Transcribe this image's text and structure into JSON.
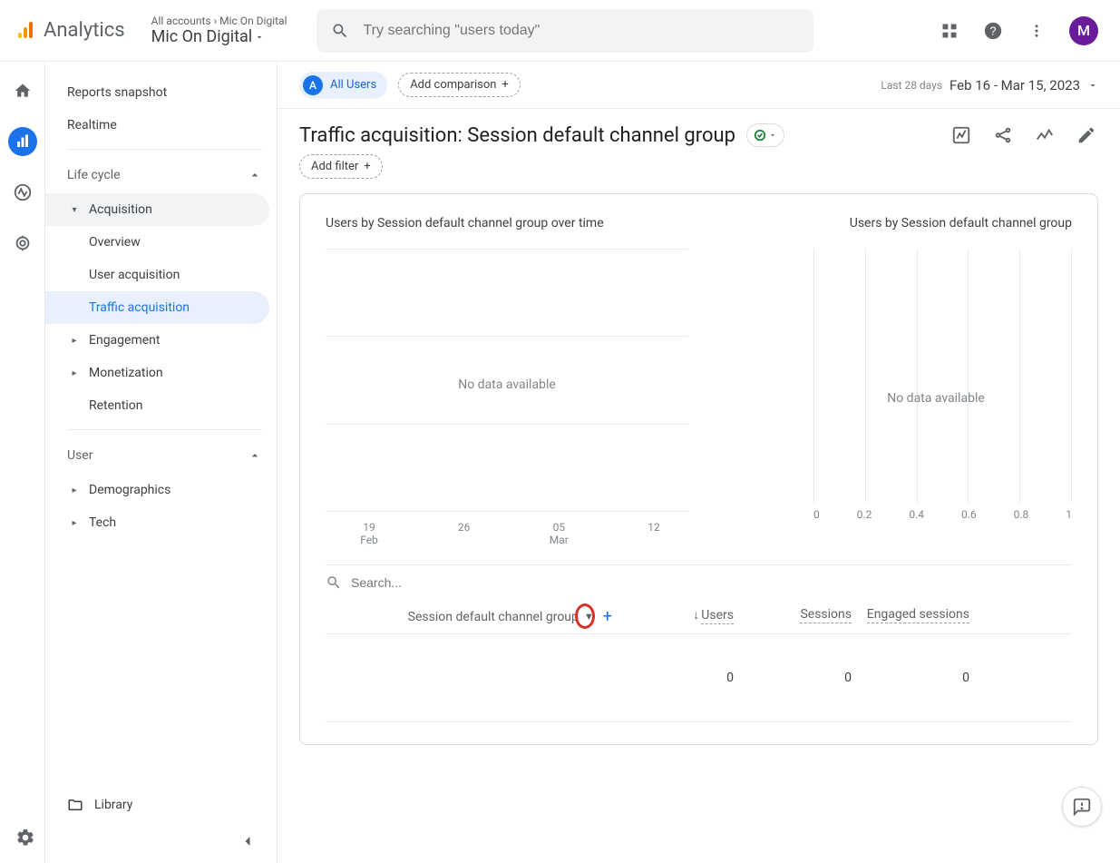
{
  "header": {
    "product": "Analytics",
    "breadcrumb_parent": "All accounts",
    "breadcrumb_child": "Mic On Digital",
    "account_name": "Mic On Digital",
    "search_placeholder": "Try searching \"users today\"",
    "avatar_initial": "M"
  },
  "sidebar": {
    "reports_snapshot": "Reports snapshot",
    "realtime": "Realtime",
    "lifecycle_label": "Life cycle",
    "acquisition": "Acquisition",
    "acq_overview": "Overview",
    "acq_user_acquisition": "User acquisition",
    "acq_traffic_acquisition": "Traffic acquisition",
    "engagement": "Engagement",
    "monetization": "Monetization",
    "retention": "Retention",
    "user_label": "User",
    "demographics": "Demographics",
    "tech": "Tech",
    "library": "Library"
  },
  "chipbar": {
    "all_users_letter": "A",
    "all_users": "All Users",
    "add_comparison": "Add comparison",
    "date_range_label": "Last 28 days",
    "date_range_value": "Feb 16 - Mar 15, 2023"
  },
  "page": {
    "title": "Traffic acquisition: Session default channel group",
    "add_filter": "Add filter"
  },
  "charts": {
    "left_title": "Users by Session default channel group over time",
    "right_title": "Users by Session default channel group",
    "no_data": "No data available"
  },
  "chart_data": [
    {
      "type": "line",
      "title": "Users by Session default channel group over time",
      "x_categories": [
        "19 Feb",
        "26",
        "05 Mar",
        "12"
      ],
      "series": [],
      "no_data": true
    },
    {
      "type": "bar",
      "title": "Users by Session default channel group",
      "x_ticks": [
        0,
        0.2,
        0.4,
        0.6,
        0.8,
        1
      ],
      "categories": [],
      "values": [],
      "no_data": true
    }
  ],
  "table": {
    "search_placeholder": "Search...",
    "dimension_label": "Session default channel group",
    "col_users": "Users",
    "col_sessions": "Sessions",
    "col_engaged": "Engaged sessions",
    "values": {
      "users": "0",
      "sessions": "0",
      "engaged": "0"
    }
  },
  "xaxis_left": [
    {
      "maj": "19",
      "min": "Feb"
    },
    {
      "maj": "26",
      "min": ""
    },
    {
      "maj": "05",
      "min": "Mar"
    },
    {
      "maj": "12",
      "min": ""
    }
  ],
  "xaxis_right": [
    "0",
    "0.2",
    "0.4",
    "0.6",
    "0.8",
    "1"
  ]
}
